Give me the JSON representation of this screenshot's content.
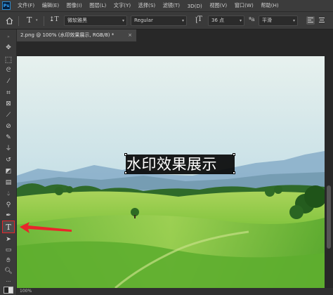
{
  "app": {
    "logo": "Ps"
  },
  "menu": [
    "文件(F)",
    "编辑(E)",
    "图像(I)",
    "图层(L)",
    "文字(Y)",
    "选择(S)",
    "滤镜(T)",
    "3D(D)",
    "视图(V)",
    "窗口(W)",
    "帮助(H)"
  ],
  "options": {
    "font_family": "微软雅黑",
    "font_style": "Regular",
    "font_size": "36 点",
    "anti_alias": "平滑"
  },
  "document": {
    "tab_title": "2.png @ 100% (水印效果展示, RGB/8) *",
    "close": "×"
  },
  "canvas": {
    "watermark_text": "水印效果展示"
  },
  "status": {
    "zoom": "100%"
  },
  "annotation": {
    "arrow_color": "#e8262b",
    "highlight_color": "#e8262b"
  },
  "icons": {
    "home": "home-icon",
    "type_tool": "text-tool-icon",
    "orientation": "text-orientation-icon",
    "size": "font-size-icon"
  }
}
